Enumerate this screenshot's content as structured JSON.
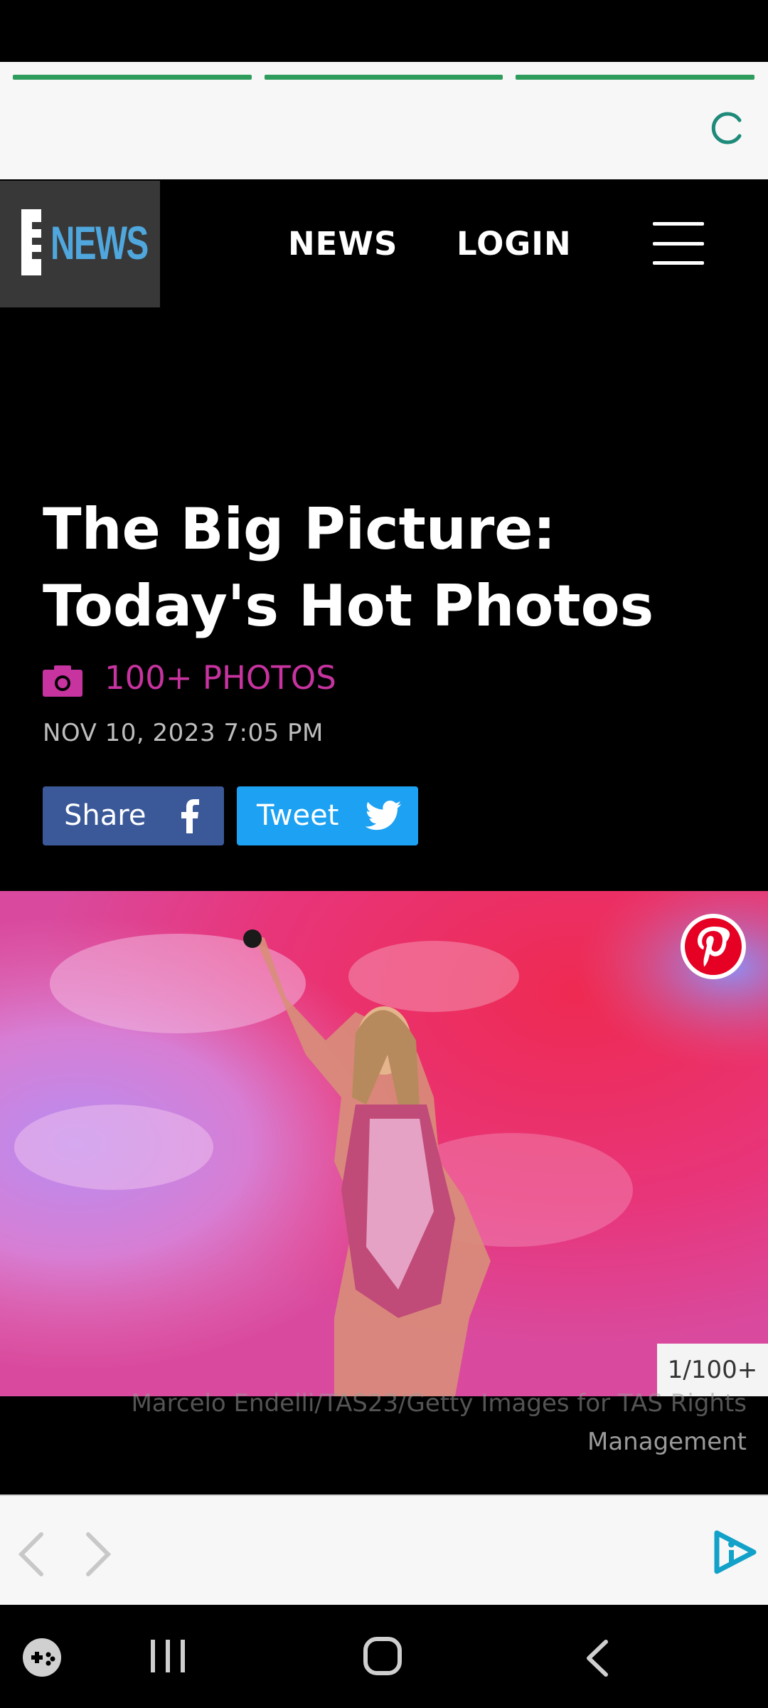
{
  "top_loader": {
    "segments": 3,
    "color": "#2e9c5c"
  },
  "header": {
    "logo_letter": "E",
    "logo_word": "NEWS",
    "nav_news": "NEWS",
    "nav_login": "LOGIN"
  },
  "article": {
    "title_line1": "The Big Picture:",
    "title_line2": "Today's Hot Photos",
    "photo_count": "100+ PHOTOS",
    "date": "NOV 10, 2023 7:05 PM",
    "share_label": "Share",
    "tweet_label": "Tweet"
  },
  "gallery": {
    "counter": "1/100+",
    "caption_line1": "Marcelo Endelli/TAS23/Getty Images for TAS Rights",
    "caption_line2": "Management"
  },
  "colors": {
    "accent_pink": "#c7339f",
    "facebook": "#3b5998",
    "twitter": "#1da1f2",
    "pinterest": "#e60023",
    "logo_blue": "#4fa7dd"
  }
}
